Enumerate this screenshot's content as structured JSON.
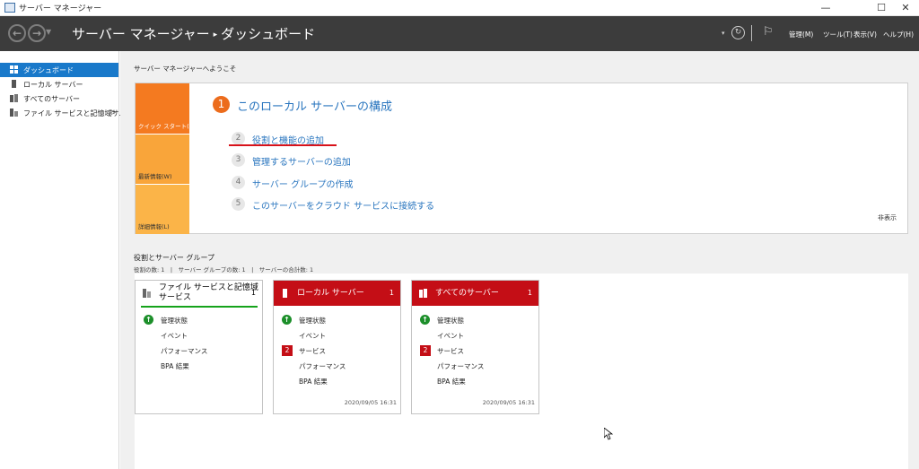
{
  "window": {
    "title": "サーバー マネージャー",
    "minimize": "—",
    "maximize": "☐",
    "close": "✕"
  },
  "header": {
    "breadcrumb_root": "サーバー マネージャー",
    "breadcrumb_sep": "▸",
    "breadcrumb_page": "ダッシュボード",
    "menus": [
      "管理(M)",
      "ツール(T)",
      "表示(V)",
      "ヘルプ(H)"
    ]
  },
  "sidebar": {
    "items": [
      {
        "label": "ダッシュボード",
        "active": true
      },
      {
        "label": "ローカル サーバー",
        "active": false
      },
      {
        "label": "すべてのサーバー",
        "active": false
      },
      {
        "label": "ファイル サービスと記憶域サ...",
        "active": false,
        "arrow": "▷"
      }
    ]
  },
  "welcome": {
    "heading": "サーバー マネージャーへようこそ",
    "tiles": [
      "クイック スタート(Q)",
      "最新情報(W)",
      "詳細情報(L)"
    ],
    "step1": {
      "num": "1",
      "label": "このローカル サーバーの構成"
    },
    "steps": [
      {
        "num": "2",
        "label": "役割と機能の追加"
      },
      {
        "num": "3",
        "label": "管理するサーバーの追加"
      },
      {
        "num": "4",
        "label": "サーバー グループの作成"
      },
      {
        "num": "5",
        "label": "このサーバーをクラウド サービスに接続する"
      }
    ],
    "hide": "非表示"
  },
  "roles": {
    "title": "役割とサーバー グループ",
    "summary": "役割の数: 1　|　サーバー グループの数: 1　|　サーバーの合計数: 1",
    "cards": [
      {
        "title": "ファイル サービスと記憶域\nサービス",
        "count": "1",
        "rows": [
          "管理状態",
          "イベント",
          "パフォーマンス",
          "BPA 結果"
        ],
        "badge": "",
        "date": ""
      },
      {
        "title": "ローカル サーバー",
        "count": "1",
        "rows": [
          "管理状態",
          "イベント",
          "サービス",
          "パフォーマンス",
          "BPA 結果"
        ],
        "badge": "2",
        "date": "2020/09/05 16:31"
      },
      {
        "title": "すべてのサーバー",
        "count": "1",
        "rows": [
          "管理状態",
          "イベント",
          "サービス",
          "パフォーマンス",
          "BPA 結果"
        ],
        "badge": "2",
        "date": "2020/09/05 16:31"
      }
    ]
  },
  "colors": {
    "accent": "#1979ca",
    "orange": "#f47a20",
    "red": "#c40e16",
    "green": "#15a31b",
    "link": "#2a76bf"
  }
}
